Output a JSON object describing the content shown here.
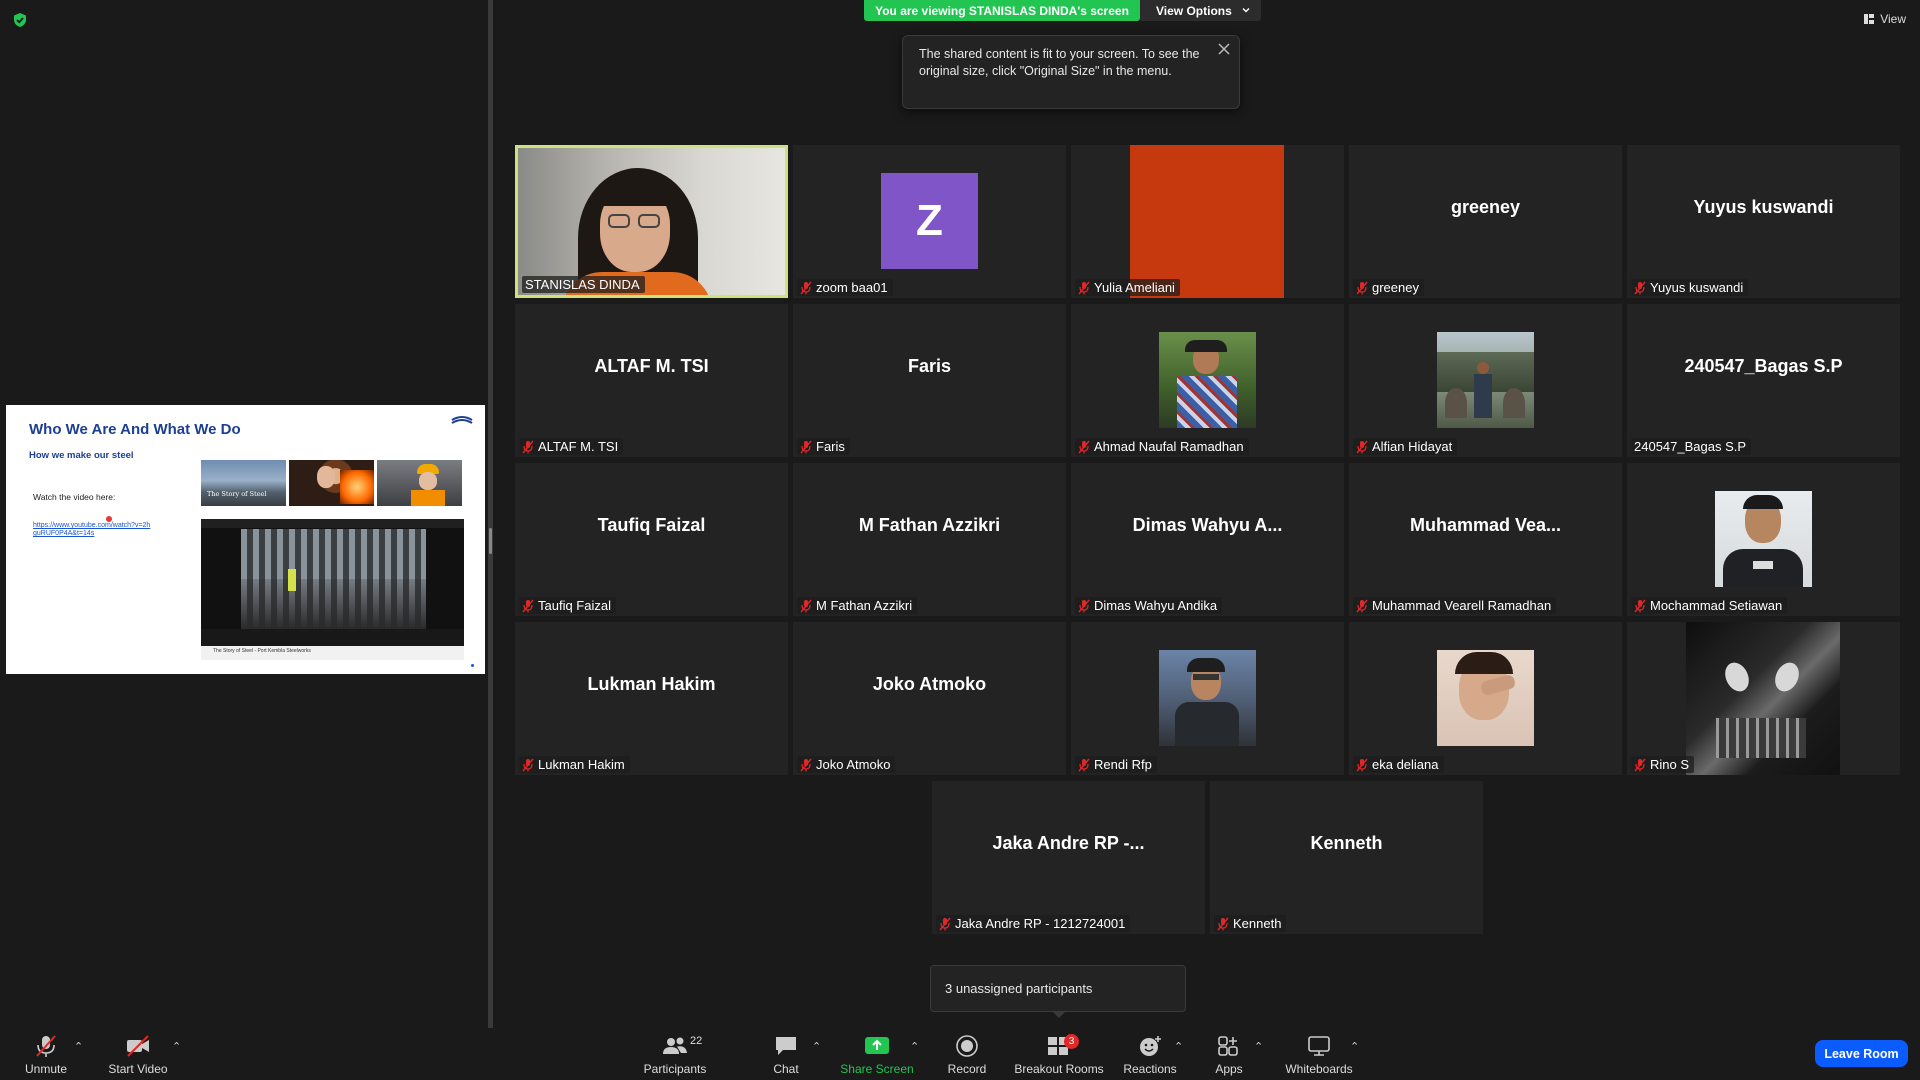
{
  "banner": {
    "viewing_text": "You are viewing STANISLAS DINDA's screen",
    "view_options_label": "View Options",
    "tooltip_text": "The shared content is fit to your screen. To see the original size, click \"Original Size\" in the menu.",
    "view_label": "View"
  },
  "slide": {
    "title": "Who We Are And What We Do",
    "subtitle": "How we make our steel",
    "watch_text": "Watch the video here:",
    "link_text": "https://www.youtube.com/watch?v=2hguRUF0P4A&t=14s",
    "thumb1_caption": "The Story of Steel",
    "video_caption": "The Story of Steel - Port Kembla Steelworks"
  },
  "participants": [
    {
      "display": "",
      "label": "STANISLAS DINDA",
      "type": "video",
      "muted": false,
      "active": true
    },
    {
      "display": "Z",
      "label": "zoom baa01",
      "type": "letter",
      "muted": true
    },
    {
      "display": "",
      "label": "Yulia Ameliani",
      "type": "color",
      "muted": true
    },
    {
      "display": "greeney",
      "label": "greeney",
      "type": "name",
      "muted": true
    },
    {
      "display": "Yuyus kuswandi",
      "label": "Yuyus kuswandi",
      "type": "name",
      "muted": true
    },
    {
      "display": "ALTAF M. TSI",
      "label": "ALTAF M. TSI",
      "type": "name",
      "muted": true
    },
    {
      "display": "Faris",
      "label": "Faris",
      "type": "name",
      "muted": true
    },
    {
      "display": "",
      "label": "Ahmad Naufal Ramadhan",
      "type": "photo",
      "muted": true
    },
    {
      "display": "",
      "label": "Alfian Hidayat",
      "type": "photo",
      "muted": true
    },
    {
      "display": "240547_Bagas S.P",
      "label": "240547_Bagas S.P",
      "type": "name",
      "muted": false
    },
    {
      "display": "Taufiq Faizal",
      "label": "Taufiq Faizal",
      "type": "name",
      "muted": true
    },
    {
      "display": "M Fathan Azzikri",
      "label": "M Fathan Azzikri",
      "type": "name",
      "muted": true
    },
    {
      "display": "Dimas Wahyu A...",
      "label": "Dimas Wahyu Andika",
      "type": "name",
      "muted": true
    },
    {
      "display": "Muhammad  Vea...",
      "label": "Muhammad Vearell Ramadhan",
      "type": "name",
      "muted": true
    },
    {
      "display": "",
      "label": "Mochammad Setiawan",
      "type": "photo",
      "muted": true
    },
    {
      "display": "Lukman Hakim",
      "label": "Lukman Hakim",
      "type": "name",
      "muted": true
    },
    {
      "display": "Joko Atmoko",
      "label": "Joko Atmoko",
      "type": "name",
      "muted": true
    },
    {
      "display": "",
      "label": "Rendi Rfp",
      "type": "photo",
      "muted": true
    },
    {
      "display": "",
      "label": "eka deliana",
      "type": "photo",
      "muted": true
    },
    {
      "display": "",
      "label": "Rino S",
      "type": "video",
      "muted": true
    },
    {
      "display": "Jaka Andre RP -...",
      "label": "Jaka Andre RP - 1212724001",
      "type": "name",
      "muted": true
    },
    {
      "display": "Kenneth",
      "label": "Kenneth",
      "type": "name",
      "muted": true
    }
  ],
  "unassigned_text": "3 unassigned participants",
  "toolbar": {
    "unmute": "Unmute",
    "start_video": "Start Video",
    "participants": "Participants",
    "participants_count": "22",
    "chat": "Chat",
    "share_screen": "Share Screen",
    "record": "Record",
    "breakout_rooms": "Breakout Rooms",
    "breakout_badge": "3",
    "reactions": "Reactions",
    "apps": "Apps",
    "whiteboards": "Whiteboards",
    "leave_room": "Leave Room"
  },
  "colors": {
    "viewing_green": "#23c552",
    "active_border": "#cde27d",
    "leave_blue": "#0b5cff",
    "muted_red": "#e02828",
    "avatar_purple": "#7f55c7",
    "avatar_orange": "#c6390f"
  }
}
